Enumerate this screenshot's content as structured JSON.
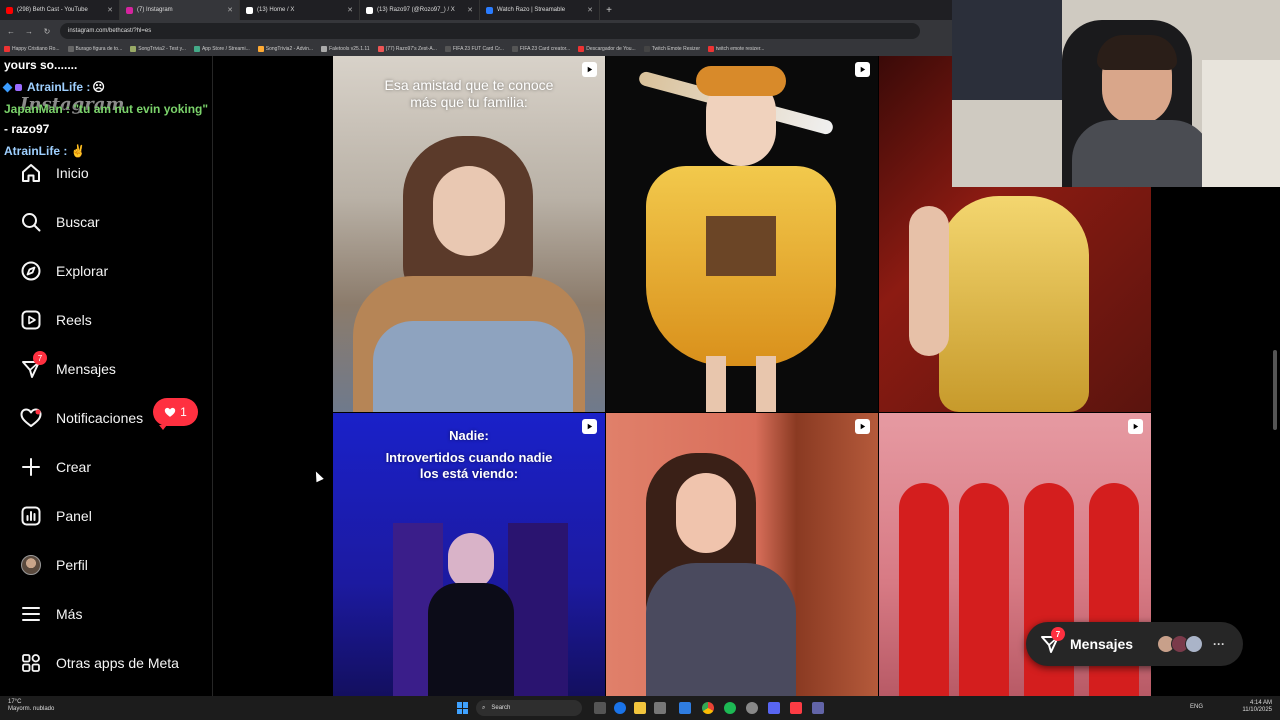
{
  "browser": {
    "tabs": [
      {
        "title": "(298) Beth Cast - YouTube",
        "color": "#ff0000"
      },
      {
        "title": "(7) Instagram",
        "color": "#d6249f",
        "active": true
      },
      {
        "title": "(13) Home / X",
        "color": "#ffffff"
      },
      {
        "title": "(13) Razo97 (@Rozo97_) / X",
        "color": "#ffffff"
      },
      {
        "title": "Watch Razo | Streamable",
        "color": "#2a7cff"
      }
    ],
    "url": "instagram.com/bethcast/?hl=es",
    "bookmarks": [
      "Happy Cristiano Ro...",
      "Burago figura de to...",
      "SongTrivia2 - Test y...",
      "App Store / Streami...",
      "SongTrivia2 - Advin...",
      "Faletools v25.1.11",
      "(77) Razo97's Zest-A...",
      "FIFA 23 FUT Card Cr...",
      "FIFA 23 Card creator...",
      "Descargador de You...",
      "Twitch Emote Resizer",
      "twitch emote resizer..."
    ]
  },
  "chat": {
    "lines": [
      "yours so.......",
      "AtrainLife : ",
      "JapanMan : \"tu am nut evin yoking\"",
      "- razo97",
      "AtrainLife : "
    ],
    "logo_text": "Instagram"
  },
  "sidebar": {
    "items": [
      {
        "label": "Inicio",
        "icon": "home-icon"
      },
      {
        "label": "Buscar",
        "icon": "search-icon"
      },
      {
        "label": "Explorar",
        "icon": "compass-icon"
      },
      {
        "label": "Reels",
        "icon": "reels-icon"
      },
      {
        "label": "Mensajes",
        "icon": "messenger-icon",
        "badge": "7"
      },
      {
        "label": "Notificaciones",
        "icon": "heart-icon"
      },
      {
        "label": "Crear",
        "icon": "plus-icon"
      },
      {
        "label": "Panel",
        "icon": "chart-icon"
      },
      {
        "label": "Perfil",
        "icon": "avatar"
      },
      {
        "label": "Más",
        "icon": "menu-icon"
      },
      {
        "label": "Otras apps de Meta",
        "icon": "apps-icon"
      }
    ],
    "notif_count": "1"
  },
  "grid": {
    "captions": {
      "tile1": [
        "Esa amistad que te conoce",
        "más que tu familia:"
      ],
      "tile4_title": "Nadie:",
      "tile4": [
        "Introvertidos cuando nadie",
        "los está viendo:"
      ]
    }
  },
  "messages_pill": {
    "label": "Mensajes",
    "badge": "7"
  },
  "taskbar": {
    "temp": "17°C",
    "weather": "Mayorm. nublado",
    "search": "Search",
    "lang": "ENG",
    "time": "4:14 AM",
    "date": "11/10/2025"
  },
  "colors": {
    "accent": "#ff3040",
    "bg": "#000000"
  }
}
